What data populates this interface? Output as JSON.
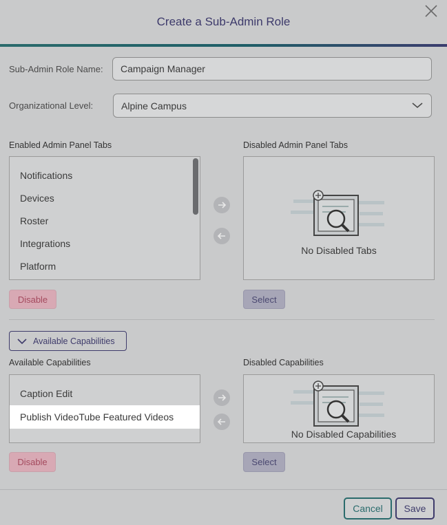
{
  "dialog": {
    "title": "Create a Sub-Admin Role"
  },
  "form": {
    "role_name_label": "Sub-Admin Role Name:",
    "role_name_value": "Campaign Manager",
    "org_level_label": "Organizational Level:",
    "org_level_value": "Alpine Campus"
  },
  "tabs_section": {
    "enabled_header": "Enabled Admin Panel Tabs",
    "disabled_header": "Disabled Admin Panel Tabs",
    "enabled_items": [
      "Notifications",
      "Devices",
      "Roster",
      "Integrations",
      "Platform"
    ],
    "disabled_empty_text": "No Disabled Tabs",
    "disable_button": "Disable",
    "select_button": "Select"
  },
  "capabilities_toggle": {
    "label": "Available Capabilities"
  },
  "capabilities_section": {
    "available_header": "Available Capabilities",
    "disabled_header": "Disabled Capabilities",
    "available_items": [
      "Caption Edit",
      "Publish VideoTube Featured Videos"
    ],
    "disabled_empty_text": "No Disabled Capabilities",
    "disable_button": "Disable",
    "select_button": "Select"
  },
  "footer": {
    "cancel_label": "Cancel",
    "save_label": "Save"
  },
  "colors": {
    "accent": "#3e3b6b",
    "teal": "#2a6b6c",
    "disable_text": "#a44a5e"
  }
}
